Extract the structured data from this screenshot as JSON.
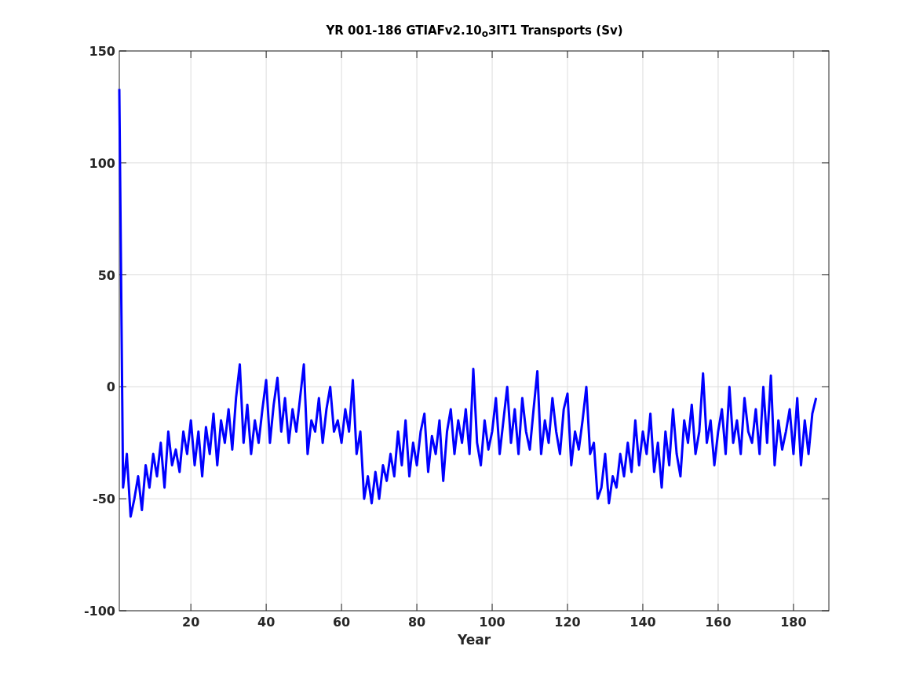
{
  "figure": {
    "chart_data": {
      "type": "line",
      "title": "YR 001-186 GTIAFv2.10$_{o}$3IT1 Transports (Sv)",
      "xlabel": "Year",
      "grid": true,
      "xlim": [
        1,
        189.4
      ],
      "ylim": [
        -100,
        150
      ],
      "xticks": [
        20,
        40,
        60,
        80,
        100,
        120,
        140,
        160,
        180
      ],
      "yticks": [
        -100,
        -50,
        0,
        50,
        100,
        150
      ],
      "x": [
        1,
        2,
        3,
        4,
        5,
        6,
        7,
        8,
        9,
        10,
        11,
        12,
        13,
        14,
        15,
        16,
        17,
        18,
        19,
        20,
        21,
        22,
        23,
        24,
        25,
        26,
        27,
        28,
        29,
        30,
        31,
        32,
        33,
        34,
        35,
        36,
        37,
        38,
        39,
        40,
        41,
        42,
        43,
        44,
        45,
        46,
        47,
        48,
        49,
        50,
        51,
        52,
        53,
        54,
        55,
        56,
        57,
        58,
        59,
        60,
        61,
        62,
        63,
        64,
        65,
        66,
        67,
        68,
        69,
        70,
        71,
        72,
        73,
        74,
        75,
        76,
        77,
        78,
        79,
        80,
        81,
        82,
        83,
        84,
        85,
        86,
        87,
        88,
        89,
        90,
        91,
        92,
        93,
        94,
        95,
        96,
        97,
        98,
        99,
        100,
        101,
        102,
        103,
        104,
        105,
        106,
        107,
        108,
        109,
        110,
        111,
        112,
        113,
        114,
        115,
        116,
        117,
        118,
        119,
        120,
        121,
        122,
        123,
        124,
        125,
        126,
        127,
        128,
        129,
        130,
        131,
        132,
        133,
        134,
        135,
        136,
        137,
        138,
        139,
        140,
        141,
        142,
        143,
        144,
        145,
        146,
        147,
        148,
        149,
        150,
        151,
        152,
        153,
        154,
        155,
        156,
        157,
        158,
        159,
        160,
        161,
        162,
        163,
        164,
        165,
        166,
        167,
        168,
        169,
        170,
        171,
        172,
        173,
        174,
        175,
        176,
        177,
        178,
        179,
        180,
        181,
        182,
        183,
        184,
        185,
        186
      ],
      "series": [
        {
          "color": "#0000ff",
          "values": [
            133,
            -45,
            -30,
            -58,
            -50,
            -40,
            -55,
            -35,
            -45,
            -30,
            -40,
            -25,
            -45,
            -20,
            -35,
            -28,
            -38,
            -20,
            -30,
            -15,
            -35,
            -20,
            -40,
            -18,
            -30,
            -12,
            -35,
            -15,
            -25,
            -10,
            -28,
            -5,
            10,
            -25,
            -8,
            -30,
            -15,
            -25,
            -10,
            3,
            -25,
            -8,
            4,
            -20,
            -5,
            -25,
            -10,
            -20,
            -5,
            10,
            -30,
            -15,
            -20,
            -5,
            -25,
            -10,
            0,
            -20,
            -15,
            -25,
            -10,
            -20,
            3,
            -30,
            -20,
            -50,
            -40,
            -52,
            -38,
            -50,
            -35,
            -42,
            -30,
            -40,
            -20,
            -35,
            -15,
            -40,
            -25,
            -35,
            -20,
            -12,
            -38,
            -22,
            -30,
            -15,
            -42,
            -20,
            -10,
            -30,
            -15,
            -25,
            -10,
            -30,
            8,
            -25,
            -35,
            -15,
            -28,
            -20,
            -5,
            -30,
            -15,
            0,
            -25,
            -10,
            -30,
            -5,
            -20,
            -28,
            -10,
            7,
            -30,
            -15,
            -25,
            -5,
            -20,
            -30,
            -10,
            -3,
            -35,
            -20,
            -28,
            -15,
            0,
            -30,
            -25,
            -50,
            -45,
            -30,
            -52,
            -40,
            -45,
            -30,
            -40,
            -25,
            -38,
            -15,
            -35,
            -20,
            -30,
            -12,
            -38,
            -25,
            -45,
            -20,
            -35,
            -10,
            -30,
            -40,
            -15,
            -25,
            -8,
            -30,
            -20,
            6,
            -25,
            -15,
            -35,
            -20,
            -10,
            -30,
            0,
            -25,
            -15,
            -30,
            -5,
            -20,
            -25,
            -10,
            -30,
            0,
            -25,
            5,
            -35,
            -15,
            -28,
            -20,
            -10,
            -30,
            -5,
            -35,
            -15,
            -30,
            -12,
            -5
          ]
        }
      ]
    }
  }
}
